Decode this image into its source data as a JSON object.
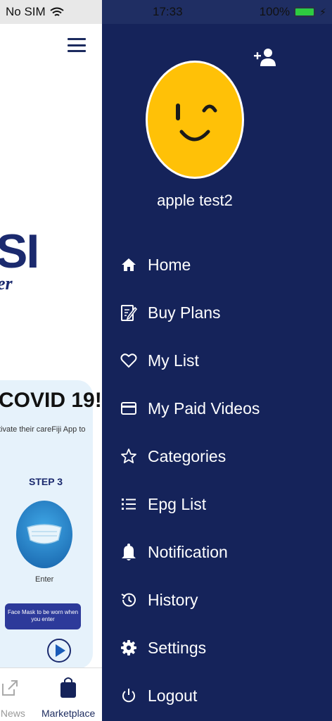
{
  "status_bar": {
    "carrier": "No SIM",
    "time": "17:33",
    "battery": "100%",
    "battery_level": 1.0
  },
  "background_app": {
    "logo_text": "SI",
    "logo_subtext": "er",
    "promo_title": "COVID 19!",
    "promo_description": "tivate their careFiji App to",
    "step_label": "STEP 3",
    "enter_label": "Enter",
    "mask_note": "Face Mask to be worn when you enter",
    "tabs": [
      {
        "label": "c News",
        "icon": "external-link-icon"
      },
      {
        "label": "Marketplace",
        "icon": "shopping-bag-icon"
      }
    ]
  },
  "drawer": {
    "user_name": "apple test2",
    "menu": [
      {
        "label": "Home",
        "icon": "home-icon"
      },
      {
        "label": "Buy Plans",
        "icon": "edit-document-icon"
      },
      {
        "label": "My List",
        "icon": "heart-icon"
      },
      {
        "label": "My Paid Videos",
        "icon": "credit-card-icon"
      },
      {
        "label": "Categories",
        "icon": "star-icon"
      },
      {
        "label": "Epg List",
        "icon": "list-icon"
      },
      {
        "label": "Notification",
        "icon": "bell-icon"
      },
      {
        "label": "History",
        "icon": "history-icon"
      },
      {
        "label": "Settings",
        "icon": "gear-icon"
      },
      {
        "label": "Logout",
        "icon": "power-icon"
      }
    ]
  },
  "colors": {
    "drawer_bg": "#15235a",
    "accent": "#1b2a6e",
    "avatar": "#ffc107"
  }
}
